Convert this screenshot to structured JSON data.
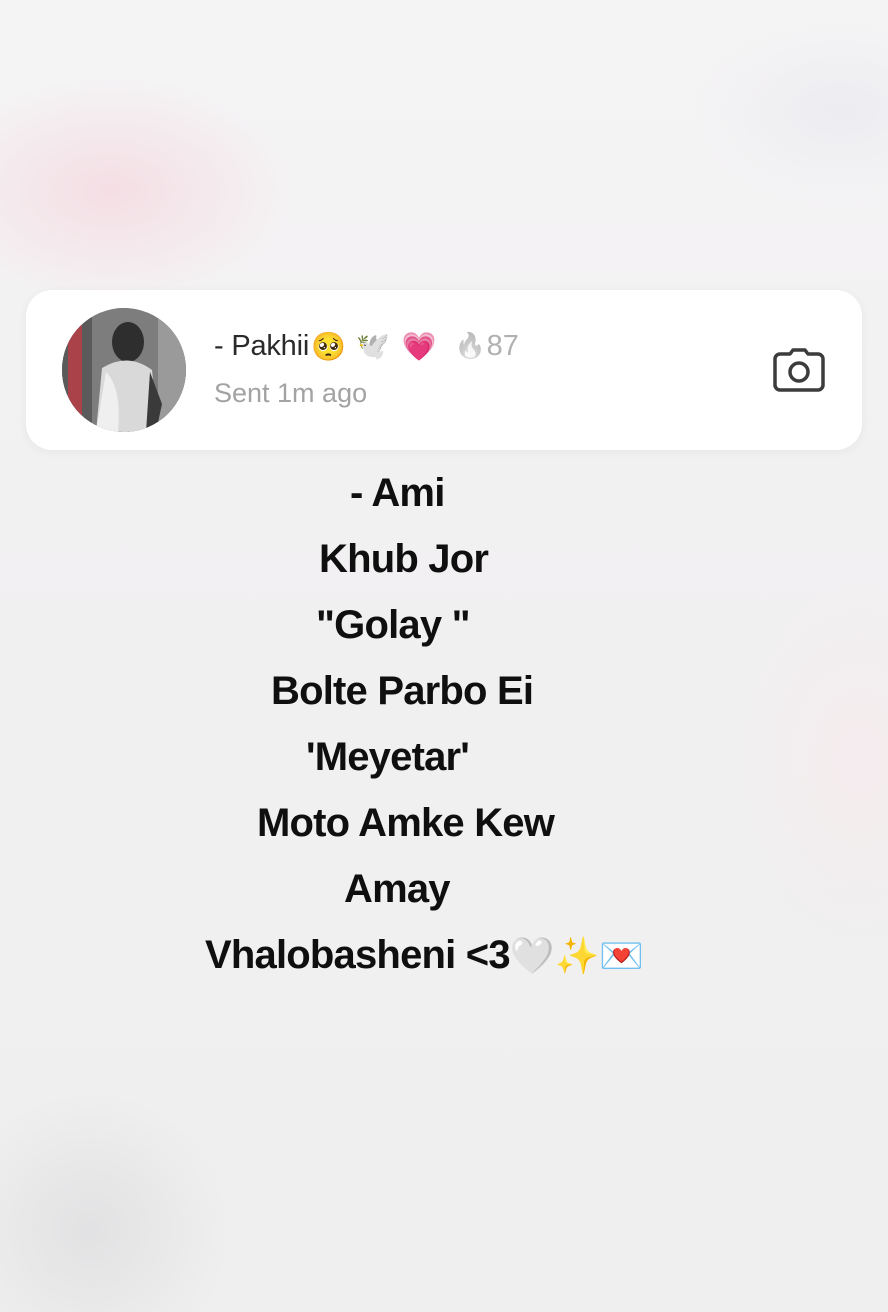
{
  "notification": {
    "sender_name": "- Pakhii",
    "name_emojis": {
      "pleading": "🥺",
      "dove": "🕊️",
      "heart": "💗"
    },
    "streak": {
      "icon": "🔥",
      "count": "87"
    },
    "timestamp": "Sent 1m ago",
    "camera_icon": "camera-icon"
  },
  "message": {
    "lines": [
      "- Ami",
      "Khub Jor",
      "\"Golay \"",
      "Bolte Parbo Ei",
      "'Meyetar'",
      "Moto Amke Kew",
      "Amay",
      "Vhalobasheni <3"
    ],
    "last_line_emojis": "🤍✨💌"
  },
  "colors": {
    "background": "#f2f1f2",
    "card": "#ffffff",
    "text_primary": "#0f0f0f",
    "text_secondary": "#a3a3a3"
  }
}
